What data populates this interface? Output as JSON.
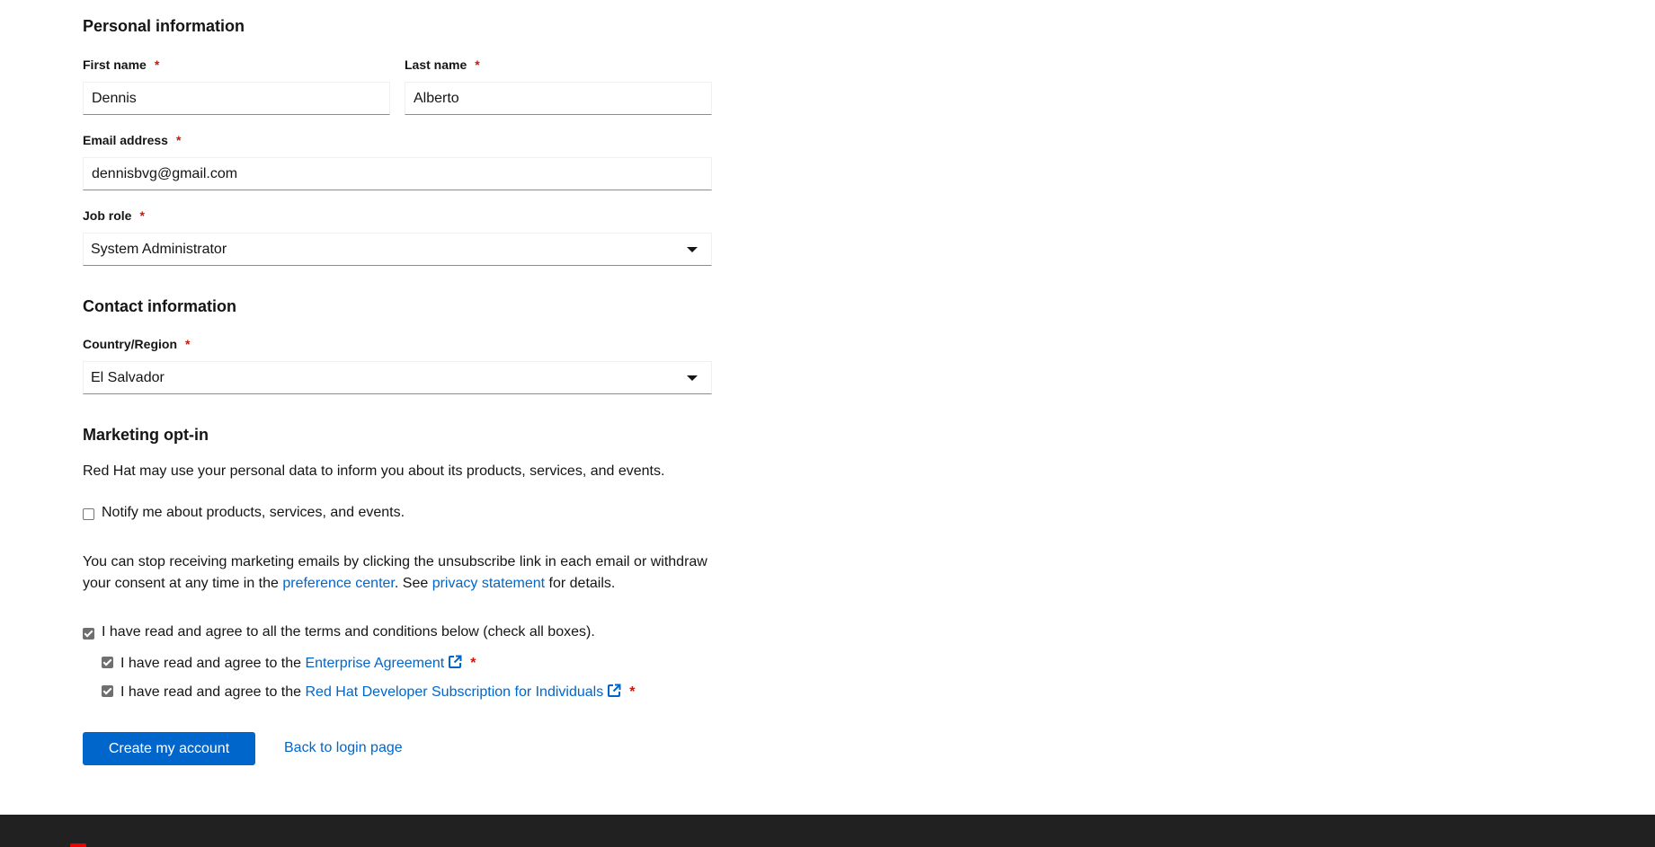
{
  "personal": {
    "heading": "Personal information",
    "first_name_label": "First name",
    "first_name_value": "Dennis",
    "last_name_label": "Last name",
    "last_name_value": "Alberto",
    "email_label": "Email address",
    "email_value": "dennisbvg@gmail.com",
    "job_role_label": "Job role",
    "job_role_value": "System Administrator",
    "required_mark": "*"
  },
  "contact": {
    "heading": "Contact information",
    "country_label": "Country/Region",
    "country_value": "El Salvador"
  },
  "marketing": {
    "heading": "Marketing opt-in",
    "description": "Red Hat may use your personal data to inform you about its products, services, and events.",
    "notify_label": "Notify me about products, services, and events.",
    "notify_checked": false,
    "unsubscribe_text_1": "You can stop receiving marketing emails by clicking the unsubscribe link in each email or withdraw your consent at any time in the ",
    "preference_center_link": "preference center",
    "unsubscribe_text_2": ". See ",
    "privacy_link": "privacy statement",
    "unsubscribe_text_3": " for details."
  },
  "terms": {
    "all_label": "I have read and agree to all the terms and conditions below (check all boxes).",
    "all_checked": true,
    "prefix": "I have read and agree to the ",
    "enterprise_link": "Enterprise Agreement",
    "enterprise_checked": true,
    "developer_link": "Red Hat Developer Subscription for Individuals",
    "developer_checked": true
  },
  "actions": {
    "create_label": "Create my account",
    "back_label": "Back to login page"
  },
  "colors": {
    "primary": "#0066cc",
    "required": "#c9190b",
    "footer": "#212121",
    "brand_red": "#ee0000"
  }
}
